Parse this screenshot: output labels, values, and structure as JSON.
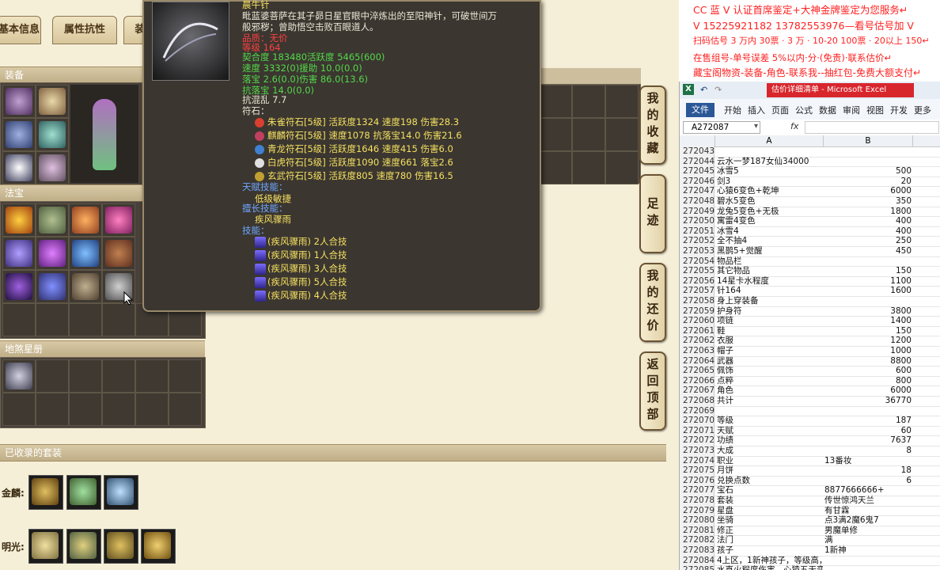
{
  "game": {
    "tabs": [
      "基本信息",
      "属性抗性",
      "装"
    ],
    "sections": {
      "equipment": "装备",
      "treasure": "法宝",
      "star": "地煞星册",
      "suits": "已收录的套装"
    },
    "suit_rows": [
      "金麟:",
      "明光:"
    ],
    "side_buttons": [
      "我的收藏",
      "足迹",
      "我的还价",
      "返回顶部"
    ]
  },
  "tooltip": {
    "name": "晨牛针",
    "desc1": "毗蓝婆菩萨在其子昴日星官眼中淬炼出的至阳神针，可破世间万",
    "desc2": "般邪秽；曾助悟空击败百眼道人。",
    "line_a": "品质：无价",
    "line_b": "等级  164",
    "stats": [
      "契合度    183480活跃度    5465(600)",
      "速度      3332(0)援助    10.0(0.0)",
      "落宝      2.6(0.0)伤害    86.0(13.6)",
      "抗落宝    14.0(0.0)",
      "抗混乱 7.7"
    ],
    "rune_title": "符石：",
    "runes": [
      {
        "text": "朱雀符石[5级] 活跃度1324 速度198 伤害28.3",
        "color": "#d84030"
      },
      {
        "text": "麒麟符石[5级] 速度1078 抗落宝14.0 伤害21.6",
        "color": "#c04060"
      },
      {
        "text": "青龙符石[5级] 活跃度1646 速度415 伤害6.0",
        "color": "#4080d0"
      },
      {
        "text": "白虎符石[5级] 活跃度1090 速度661 落宝2.6",
        "color": "#e0e0e0"
      },
      {
        "text": "玄武符石[5级] 活跃度805 速度780 伤害16.5",
        "color": "#c0a030"
      }
    ],
    "talent_title": "天赋技能：",
    "talent": "低级敏捷",
    "special_title": "擅长技能：",
    "special": "疾风骤雨",
    "skill_title": "技能：",
    "skills": [
      "(疾风骤雨) 2人合技",
      "(疾风骤雨) 1人合技",
      "(疾风骤雨) 3人合技",
      "(疾风骤雨) 5人合技",
      "(疾风骤雨) 4人合技"
    ]
  },
  "ad": {
    "line1": "CC 蓝 V 认证首席鉴定+大神金牌鉴定为您服务↵",
    "line2": "V 15225921182      13782553976—看号估号加 V",
    "line3": "扫码估号 3 万内 30票 · 3        万  · 10-20 100票 · 20以上 150↵",
    "line4": "在售组号-单号误差 5%以内·分·(免责)·联系估价↵",
    "line5": "藏宝阁物资-装备-角色-联系我--抽红包-免费大额支付↵"
  },
  "excel": {
    "title": "估价详细清单 - Microsoft Excel",
    "tabs": [
      "文件",
      "开始",
      "插入",
      "页面",
      "公式",
      "数据",
      "审阅",
      "视图",
      "开发",
      "更多"
    ],
    "name_box": "A272087",
    "fx": "fx",
    "col_a": "A",
    "col_b": "B",
    "rows": [
      [
        "272043",
        "",
        ""
      ],
      [
        "272044",
        "云水一梦187女仙34000",
        ""
      ],
      [
        "272045",
        "冰雪5",
        "500"
      ],
      [
        "272046",
        "剑3",
        "20"
      ],
      [
        "272047",
        "心猿6变色+乾坤",
        "6000"
      ],
      [
        "272048",
        "碧水5变色",
        "350"
      ],
      [
        "272049",
        "龙兔5变色+无极",
        "1800"
      ],
      [
        "272050",
        "寓雷4变色",
        "400"
      ],
      [
        "272051",
        "冰雪4",
        "400"
      ],
      [
        "272052",
        "全不抽4",
        "250"
      ],
      [
        "272053",
        "黑鹊5+觉醒",
        "450"
      ],
      [
        "272054",
        "物品栏",
        ""
      ],
      [
        "272055",
        "其它物品",
        "150"
      ],
      [
        "272056",
        "14星卡水程度",
        "1100"
      ],
      [
        "272057",
        "针164",
        "1600"
      ],
      [
        "272058",
        "身上穿装备",
        ""
      ],
      [
        "272059",
        "护身符",
        "3800"
      ],
      [
        "272060",
        "项链",
        "1400"
      ],
      [
        "272061",
        "鞋",
        "150"
      ],
      [
        "272062",
        "衣服",
        "1200"
      ],
      [
        "272063",
        "帽子",
        "1000"
      ],
      [
        "272064",
        "武器",
        "8800"
      ],
      [
        "272065",
        "佩饰",
        "600"
      ],
      [
        "272066",
        "点粹",
        "800"
      ],
      [
        "272067",
        "角色",
        "6000"
      ],
      [
        "272068",
        "共计",
        "36770"
      ],
      [
        "272069",
        "",
        ""
      ],
      [
        "272070",
        "等级",
        "187"
      ],
      [
        "272071",
        "天赋",
        "60"
      ],
      [
        "272072",
        "功绩",
        "7637"
      ],
      [
        "272073",
        "大成",
        "8"
      ],
      [
        "272074",
        "职业",
        "13番妆"
      ],
      [
        "272075",
        "月饼",
        "18"
      ],
      [
        "272076",
        "兑换点数",
        "6"
      ],
      [
        "272077",
        "宝石",
        "8877666666+"
      ],
      [
        "272078",
        "套装",
        "传世惊鸿天兰"
      ],
      [
        "272079",
        "星盘",
        "有甘霖"
      ],
      [
        "272080",
        "坐骑",
        "点3满2魔6鬼7"
      ],
      [
        "272081",
        "修正",
        "男魔单修"
      ],
      [
        "272082",
        "法门",
        "满"
      ],
      [
        "272083",
        "孩子",
        "1新神"
      ],
      [
        "272084",
        "4上区，1新神孩子，等级高，法门满，传世惊鸿4阶",
        ""
      ],
      [
        "272085",
        "水直火程度伤害，心猿五无变奇，装备完完完全",
        ""
      ]
    ]
  }
}
